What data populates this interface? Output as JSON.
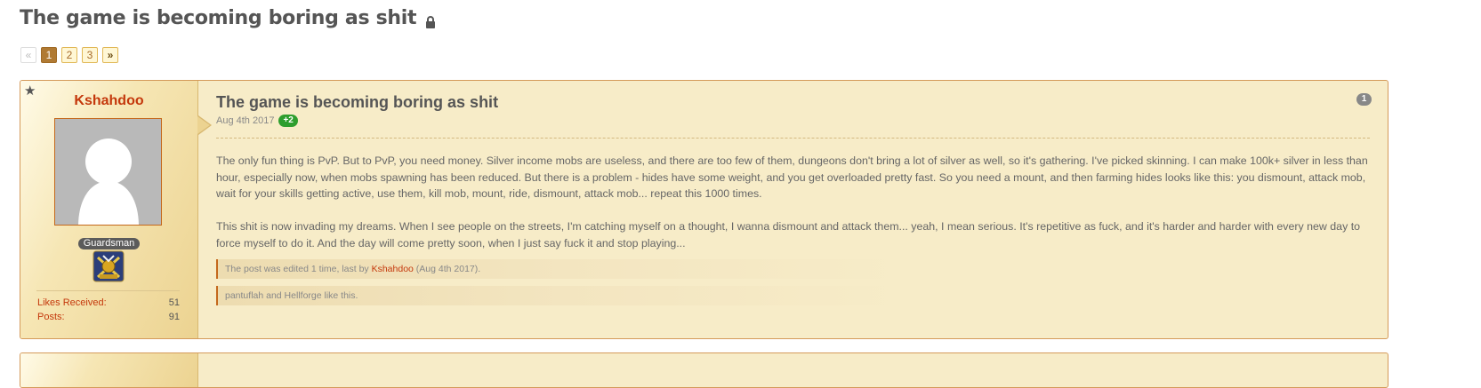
{
  "thread": {
    "title": "The game is becoming boring as shit"
  },
  "pagination": {
    "prev_label": "«",
    "pages": [
      "1",
      "2",
      "3"
    ],
    "active_page": "1",
    "next_label": "»"
  },
  "post": {
    "author": {
      "name": "Kshahdoo",
      "rank": "Guardsman",
      "stats": [
        {
          "label": "Likes Received:",
          "value": "51"
        },
        {
          "label": "Posts:",
          "value": "91"
        }
      ]
    },
    "title": "The game is becoming boring as shit",
    "date": "Aug 4th 2017",
    "likes": "+2",
    "number": "1",
    "paragraphs": [
      "The only fun thing is PvP. But to PvP, you need money. Silver income mobs are useless, and there are too few of them, dungeons don't bring a lot of silver as well, so it's gathering. I've picked skinning. I can make 100k+ silver in less than hour, especially now, when mobs spawning has been reduced. But there is a problem - hides have some weight, and you get overloaded pretty fast. So you need a mount, and then farming hides looks like this: you dismount, attack mob, wait for your skills getting active, use them, kill mob, mount, ride, dismount, attack mob... repeat this 1000 times.",
      "This shit is now invading my dreams. When I see people on the streets, I'm catching myself on a thought, I wanna dismount and attack them... yeah, I mean serious. It's repetitive as fuck, and it's harder and harder with every new day to force myself to do it. And the day will come pretty soon, when I just say fuck it and stop playing..."
    ],
    "edit_note": {
      "prefix": "The post was edited 1 time, last by ",
      "user": "Kshahdoo",
      "suffix": " (Aug 4th 2017)."
    },
    "likes_note": "pantuflah and Hellforge like this."
  },
  "colors": {
    "accent": "#c4380c",
    "post_bg": "#f7ecc8",
    "likes_badge": "#2e9e2e"
  },
  "icons": {
    "title_lock": "lock-icon",
    "sidebar_star": "star-icon",
    "rank": "rank-emblem-icon"
  }
}
